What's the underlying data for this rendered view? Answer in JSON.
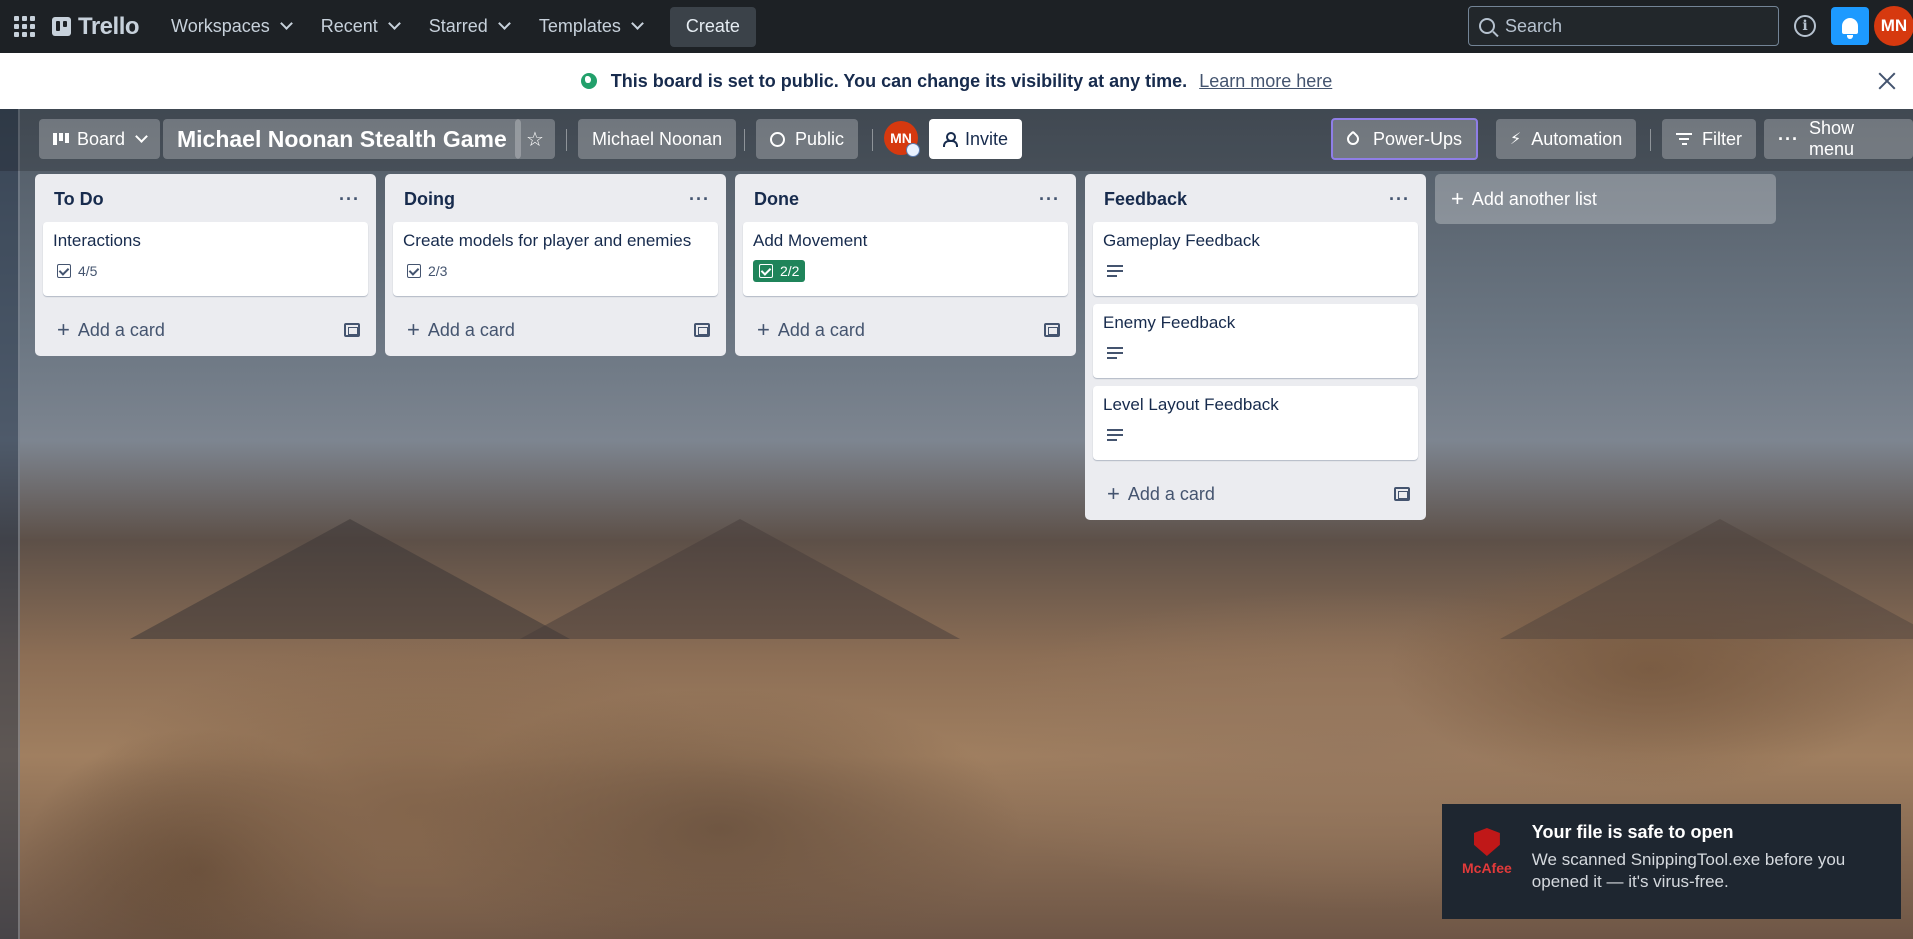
{
  "topnav": {
    "app_name": "Trello",
    "menus": [
      "Workspaces",
      "Recent",
      "Starred",
      "Templates"
    ],
    "create_label": "Create",
    "search_placeholder": "Search",
    "user_initials": "MN",
    "notification_color": "#1d9aff"
  },
  "banner": {
    "message": "This board is set to public. You can change its visibility at any time.",
    "link": "Learn more here"
  },
  "board": {
    "view_label": "Board",
    "title": "Michael Noonan Stealth Game",
    "workspace": "Michael Noonan",
    "visibility": "Public",
    "member_initials": "MN",
    "invite_label": "Invite",
    "powerups_label": "Power-Ups",
    "automation_label": "Automation",
    "filter_label": "Filter",
    "show_menu_label": "Show menu",
    "add_list_label": "Add another list",
    "add_card_label": "Add a card",
    "lists": [
      {
        "title": "To Do",
        "cards": [
          {
            "title": "Interactions",
            "checklist": "4/5",
            "complete": false
          }
        ]
      },
      {
        "title": "Doing",
        "cards": [
          {
            "title": "Create models for player and enemies",
            "checklist": "2/3",
            "complete": false
          }
        ]
      },
      {
        "title": "Done",
        "cards": [
          {
            "title": "Add Movement",
            "checklist": "2/2",
            "complete": true
          }
        ]
      },
      {
        "title": "Feedback",
        "cards": [
          {
            "title": "Gameplay Feedback",
            "description": true
          },
          {
            "title": "Enemy Feedback",
            "description": true
          },
          {
            "title": "Level Layout Feedback",
            "description": true
          }
        ]
      }
    ]
  },
  "toast": {
    "brand": "McAfee",
    "title": "Your file is safe to open",
    "body": "We scanned SnippingTool.exe before you opened it — it's virus-free."
  }
}
